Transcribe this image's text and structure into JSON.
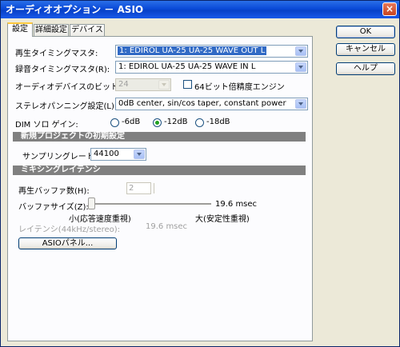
{
  "window": {
    "title": "オーディオオプション － ASIO",
    "close_symbol": "×"
  },
  "tabs": [
    {
      "label": "設定",
      "active": true
    },
    {
      "label": "詳細設定",
      "active": false
    },
    {
      "label": "デバイス",
      "active": false
    }
  ],
  "settings": {
    "playback_timing_master": {
      "label": "再生タイミングマスタ:",
      "value": "1: EDIROL UA-25 UA-25 WAVE OUT L"
    },
    "record_timing_master": {
      "label": "録音タイミングマスタ(R):",
      "value": "1: EDIROL UA-25 UA-25 WAVE IN L"
    },
    "bit_depth": {
      "label": "オーディオデバイスのビット数(T):",
      "value": "24"
    },
    "engine_64bit": {
      "label": "64ビット倍精度エンジン",
      "checked": false
    },
    "stereo_panning": {
      "label": "ステレオパンニング設定(L):",
      "value": "0dB center, sin/cos taper, constant power"
    },
    "dim_solo": {
      "label": "DIM ソロ ゲイン:",
      "options": [
        "-6dB",
        "-12dB",
        "-18dB"
      ],
      "selected": "-12dB"
    }
  },
  "new_project": {
    "heading": "新規プロジェクトの初期設定",
    "sample_rate": {
      "label": "サンプリングレート(S):",
      "value": "44100"
    }
  },
  "mixing_latency": {
    "heading": "ミキシングレイテンシ",
    "buffer_count": {
      "label": "再生バッファ数(H):",
      "value": "2"
    },
    "buffer_size": {
      "label": "バッファサイズ(Z):",
      "value_text": "19.6 msec",
      "min_label": "小(応答速度重視)",
      "max_label": "大(安定性重視)",
      "position_fraction": 0
    },
    "latency": {
      "label": "レイテンシ(44kHz/stereo):",
      "value": "19.6 msec"
    },
    "asio_panel_button": "ASIOパネル..."
  },
  "buttons": {
    "ok": "OK",
    "cancel": "キャンセル",
    "help": "ヘルプ"
  },
  "colors": {
    "titlebar": "#0a4ad8",
    "selection": "#316ac5",
    "section_header": "#808080",
    "radio_dot": "#21a121"
  }
}
